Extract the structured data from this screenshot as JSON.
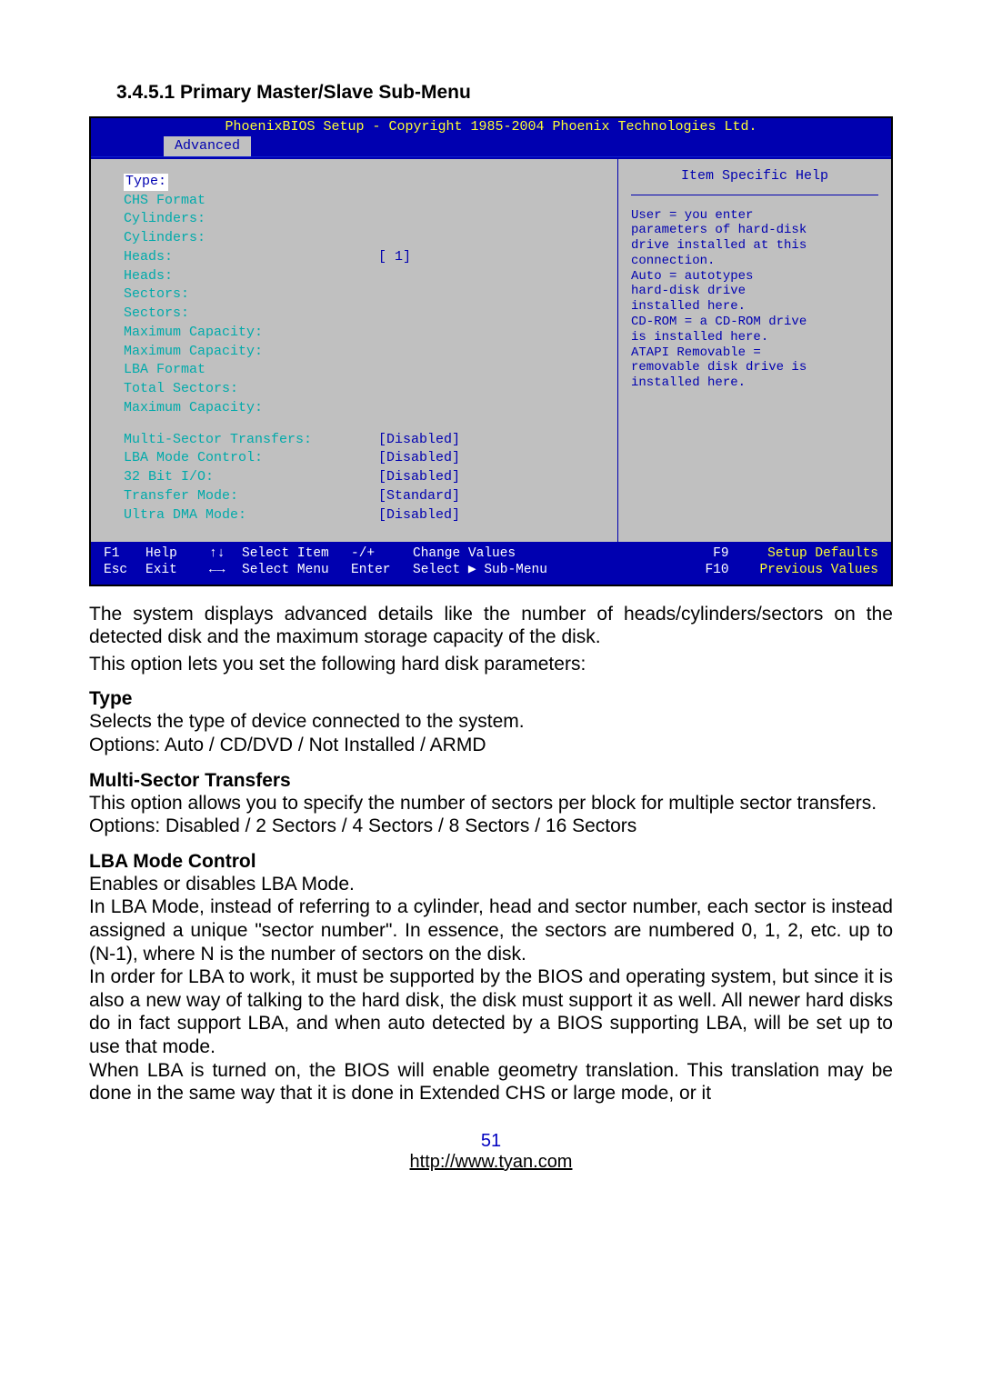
{
  "heading": "3.4.5.1  Primary Master/Slave Sub-Menu",
  "bios": {
    "title": "PhoenixBIOS Setup - Copyright 1985-2004 Phoenix Technologies Ltd.",
    "tab": "Advanced",
    "help_title": "Item Specific Help",
    "help_body": "User = you enter\nparameters of hard-disk\ndrive installed at this\nconnection.\nAuto = autotypes\nhard-disk drive\ninstalled here.\nCD-ROM = a CD-ROM drive\nis installed here.\nATAPI Removable =\nremovable disk drive is\ninstalled here.",
    "rows1": [
      {
        "label": "Type:",
        "value": "",
        "selected": true
      },
      {
        "label": "CHS Format",
        "value": ""
      },
      {
        "label": "Cylinders:",
        "value": ""
      },
      {
        "label": "Cylinders:",
        "value": ""
      },
      {
        "label": "Heads:",
        "value": "[  1]"
      },
      {
        "label": "Heads:",
        "value": ""
      },
      {
        "label": "Sectors:",
        "value": ""
      },
      {
        "label": "Sectors:",
        "value": ""
      },
      {
        "label": "Maximum Capacity:",
        "value": ""
      },
      {
        "label": "Maximum Capacity:",
        "value": ""
      },
      {
        "label": "LBA Format",
        "value": ""
      },
      {
        "label": "Total Sectors:",
        "value": ""
      },
      {
        "label": "Maximum Capacity:",
        "value": ""
      }
    ],
    "rows2": [
      {
        "label": "Multi-Sector Transfers:",
        "value": "[Disabled]"
      },
      {
        "label": "LBA Mode Control:",
        "value": "[Disabled]"
      },
      {
        "label": "32 Bit I/O:",
        "value": "[Disabled]"
      },
      {
        "label": "Transfer Mode:",
        "value": "[Standard]"
      },
      {
        "label": "Ultra DMA Mode:",
        "value": "[Disabled]"
      }
    ],
    "footer": {
      "r1": {
        "k1": "F1",
        "l1": "Help",
        "a1": "↑↓",
        "l2": "Select Item",
        "k2": "-/+",
        "l3": "Change Values",
        "k3": "F9",
        "l4": "Setup Defaults"
      },
      "r2": {
        "k1": "Esc",
        "l1": "Exit",
        "a1": "←→",
        "l2": "Select Menu",
        "k2": "Enter",
        "l3": "Select ▶ Sub-Menu",
        "k3": "F10",
        "l4": "Previous Values"
      }
    }
  },
  "para1": "The system displays advanced details like the number of heads/cylinders/sectors on the detected disk and the maximum storage capacity of the disk.",
  "para2": "This option lets you set the following hard disk parameters:",
  "type_h": "Type",
  "type_p1": "Selects the type of device connected to the system.",
  "type_p2": "Options: Auto / CD/DVD / Not Installed / ARMD",
  "mst_h": "Multi-Sector Transfers",
  "mst_p1": "This option allows you to specify the number of sectors per block for multiple sector transfers.",
  "mst_p2": "Options: Disabled / 2 Sectors / 4 Sectors / 8 Sectors / 16 Sectors",
  "lba_h": "LBA Mode Control",
  "lba_p1": "Enables or disables LBA Mode.",
  "lba_p2": "In LBA Mode, instead of referring to a cylinder, head and sector number, each sector is instead assigned a unique \"sector number\". In essence, the sectors are numbered 0, 1, 2, etc. up to (N-1), where N is the number of sectors on the disk.",
  "lba_p3": "In order for LBA to work, it must be supported by the BIOS and operating system, but since it is also a new way of talking to the hard disk, the disk must support it as well. All newer hard disks do in fact support LBA, and when auto detected by a BIOS supporting LBA, will be set up to use that mode.",
  "lba_p4": "When LBA is turned on, the BIOS will enable geometry translation. This translation may be done in the same way that it is done in Extended CHS or large mode, or it",
  "pagenum": "51",
  "url": "http://www.tyan.com"
}
